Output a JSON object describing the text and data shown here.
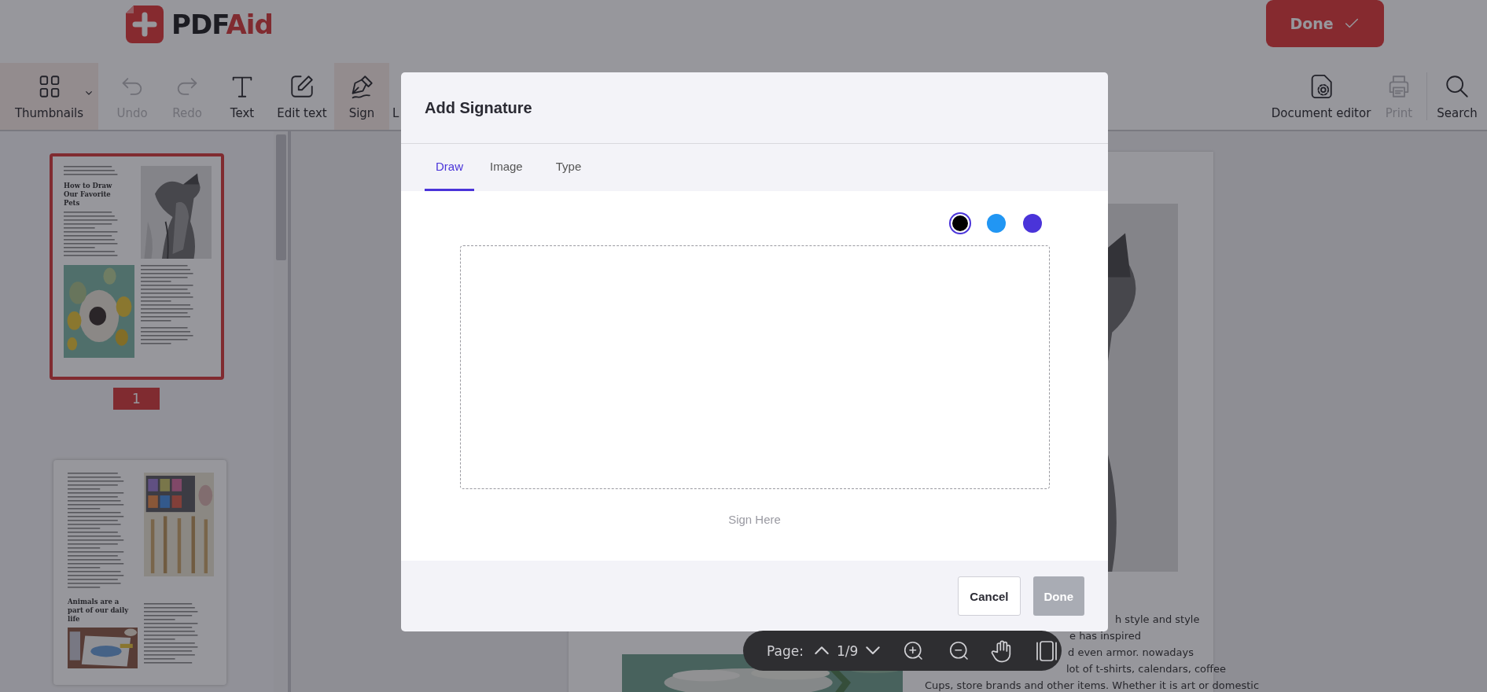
{
  "header": {
    "logo": {
      "name": "PDF",
      "accent": "Aid"
    },
    "done_button": "Done"
  },
  "toolbar": {
    "left": [
      {
        "label": "Thumbnails",
        "active": true,
        "disabled": false
      },
      {
        "label": "Undo",
        "active": false,
        "disabled": true
      },
      {
        "label": "Redo",
        "active": false,
        "disabled": true
      },
      {
        "label": "Text",
        "active": false,
        "disabled": false
      },
      {
        "label": "Edit text",
        "active": false,
        "disabled": false
      },
      {
        "label": "Sign",
        "active": true,
        "disabled": false
      },
      {
        "label": "L",
        "active": false,
        "disabled": false
      }
    ],
    "right": [
      {
        "label": "Document editor",
        "active": false,
        "disabled": false
      },
      {
        "label": "Print",
        "active": false,
        "disabled": true
      },
      {
        "label": "Search",
        "active": false,
        "disabled": false
      }
    ]
  },
  "thumbnails": [
    {
      "kind": "heading-top",
      "heading": "How to Draw Our Favorite Pets",
      "label": "1",
      "selected": true
    },
    {
      "kind": "heading-bottom",
      "heading": "Animals are a part of our daily life",
      "selected": false
    }
  ],
  "document": {
    "lines": [
      "h style and style",
      "e has inspired",
      "d even armor. nowadays",
      "lot of t-shirts, calendars, coffee",
      "Cups, store brands and other items. Whether it is art or domestic"
    ]
  },
  "modal": {
    "title": "Add Signature",
    "tabs": [
      {
        "label": "Draw",
        "selected": true
      },
      {
        "label": "Image",
        "selected": false
      },
      {
        "label": "Type",
        "selected": false
      }
    ],
    "colors": [
      {
        "color": "#000000",
        "selected": true
      },
      {
        "color": "#2196f3",
        "selected": false
      },
      {
        "color": "#4a34d9",
        "selected": false
      }
    ],
    "hint": "Sign Here",
    "cancel_button": "Cancel",
    "done_button": {
      "label": "Done",
      "disabled": true
    }
  },
  "page_nav": {
    "label": "Page:",
    "current": "1/9"
  }
}
